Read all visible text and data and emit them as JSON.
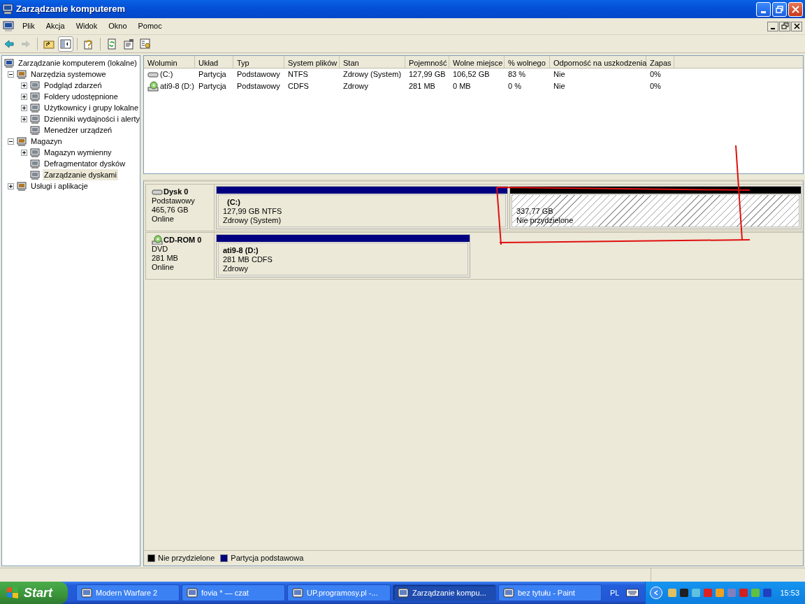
{
  "window": {
    "title": "Zarządzanie komputerem"
  },
  "menu": [
    "Plik",
    "Akcja",
    "Widok",
    "Okno",
    "Pomoc"
  ],
  "toolbar": [
    {
      "kind": "back",
      "disabled": false,
      "pressed": false
    },
    {
      "kind": "forward",
      "disabled": true,
      "pressed": false
    },
    {
      "kind": "sep"
    },
    {
      "kind": "up",
      "disabled": false,
      "pressed": false
    },
    {
      "kind": "tree",
      "disabled": false,
      "pressed": true
    },
    {
      "kind": "sep"
    },
    {
      "kind": "help",
      "disabled": false,
      "pressed": false
    },
    {
      "kind": "sep"
    },
    {
      "kind": "refresh",
      "disabled": false,
      "pressed": false
    },
    {
      "kind": "properties",
      "disabled": false,
      "pressed": false
    },
    {
      "kind": "export",
      "disabled": false,
      "pressed": false
    }
  ],
  "tree": [
    {
      "label": "Zarządzanie komputerem (lokalne)",
      "selected": false,
      "children": [
        {
          "label": "Narzędzia systemowe",
          "expandable": true,
          "expanded": true,
          "selected": false,
          "children": [
            {
              "label": "Podgląd zdarzeń",
              "expandable": true,
              "expanded": false,
              "selected": false
            },
            {
              "label": "Foldery udostępnione",
              "expandable": true,
              "expanded": false,
              "selected": false
            },
            {
              "label": "Użytkownicy i grupy lokalne",
              "expandable": true,
              "expanded": false,
              "selected": false
            },
            {
              "label": "Dzienniki wydajności i alerty",
              "expandable": true,
              "expanded": false,
              "selected": false
            },
            {
              "label": "Menedżer urządzeń",
              "expandable": false,
              "selected": false
            }
          ]
        },
        {
          "label": "Magazyn",
          "expandable": true,
          "expanded": true,
          "selected": false,
          "children": [
            {
              "label": "Magazyn wymienny",
              "expandable": true,
              "expanded": false,
              "selected": false
            },
            {
              "label": "Defragmentator dysków",
              "expandable": false,
              "selected": false
            },
            {
              "label": "Zarządzanie dyskami",
              "expandable": false,
              "selected": true
            }
          ]
        },
        {
          "label": "Usługi i aplikacje",
          "expandable": true,
          "expanded": false,
          "selected": false
        }
      ]
    }
  ],
  "volumes": {
    "columns": [
      "Wolumin",
      "Układ",
      "Typ",
      "System plików",
      "Stan",
      "Pojemność",
      "Wolne miejsce",
      "% wolnego",
      "Odporność na uszkodzenia",
      "Zapas"
    ],
    "rows": [
      {
        "kind": "hdd",
        "cells": [
          "(C:)",
          "Partycja",
          "Podstawowy",
          "NTFS",
          "Zdrowy (System)",
          "127,99 GB",
          "106,52 GB",
          "83 %",
          "Nie",
          "0%"
        ]
      },
      {
        "kind": "cd",
        "cells": [
          "ati9-8 (D:)",
          "Partycja",
          "Podstawowy",
          "CDFS",
          "Zdrowy",
          "281 MB",
          "0 MB",
          "0 %",
          "Nie",
          "0%"
        ]
      }
    ]
  },
  "disks": [
    {
      "kind": "hdd",
      "name": "Dysk 0",
      "type": "Podstawowy",
      "size": "465,76 GB",
      "status": "Online",
      "partitions": [
        {
          "kind": "primary",
          "label": "(C:)",
          "size_fs": "127,99 GB NTFS",
          "status": "Zdrowy (System)"
        },
        {
          "kind": "unallocated",
          "size_fs": "337,77 GB",
          "status": "Nie przydzielone"
        }
      ]
    },
    {
      "kind": "cd",
      "name": "CD-ROM 0",
      "type": "DVD",
      "size": "281 MB",
      "status": "Online",
      "partitions": [
        {
          "kind": "primary",
          "label": "ati9-8  (D:)",
          "size_fs": "281 MB CDFS",
          "status": "Zdrowy"
        }
      ]
    }
  ],
  "legend": [
    {
      "label": "Nie przydzielone",
      "color": "#000000"
    },
    {
      "label": "Partycja podstawowa",
      "color": "#000080"
    }
  ],
  "taskbar": {
    "start": "Start",
    "tasks": [
      {
        "label": "Modern Warfare 2",
        "selected": false
      },
      {
        "label": "fovia * — czat",
        "selected": false
      },
      {
        "label": "UP.programosy.pl -...",
        "selected": false
      },
      {
        "label": "Zarządzanie kompu...",
        "selected": true
      },
      {
        "label": "bez tytułu - Paint",
        "selected": false
      }
    ],
    "language": "PL",
    "clock": "15:53"
  }
}
